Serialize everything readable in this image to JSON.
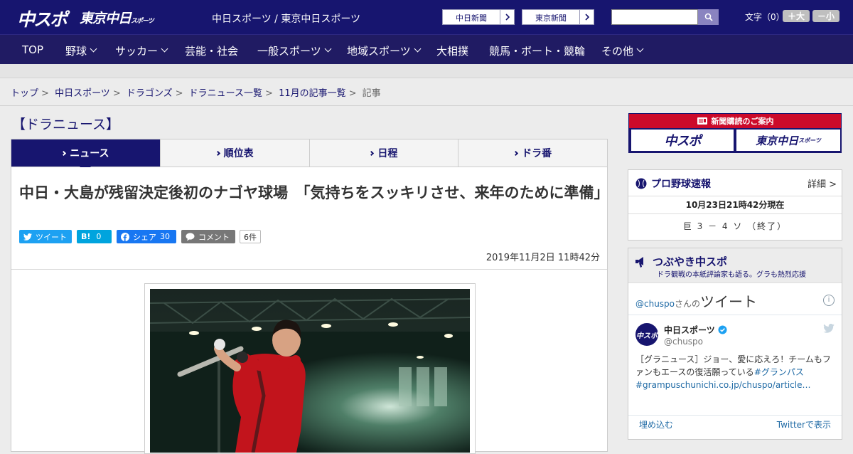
{
  "header": {
    "logo_chuspo": "中スポ",
    "logo_tokyo": "東京中日",
    "logo_tokyo_small": "スポーツ",
    "site_title": "中日スポーツ / 東京中日スポーツ",
    "ext_links": [
      "中日新聞",
      "東京新聞"
    ],
    "font_size_label": "文字（0）",
    "font_bigger": "＋大",
    "font_smaller": "－小"
  },
  "nav": {
    "items": [
      "TOP",
      "野球",
      "サッカー",
      "芸能・社会",
      "一般スポーツ",
      "地域スポーツ",
      "大相撲",
      "競馬・ボート・競輪",
      "その他"
    ]
  },
  "breadcrumb": [
    "トップ",
    "中日スポーツ",
    "ドラゴンズ",
    "ドラニュース一覧",
    "11月の記事一覧",
    "記事"
  ],
  "main": {
    "section_title": "【ドラニュース】",
    "tabs": [
      "ニュース",
      "順位表",
      "日程",
      "ドラ番"
    ],
    "headline": "中日・大島が残留決定後初のナゴヤ球場　「気持ちをスッキリさせ、来年のために準備」",
    "share": {
      "tweet": "ツイート",
      "hatena_label": "B!",
      "hatena_count": "0",
      "facebook": "シェア",
      "facebook_count": "30",
      "comment": "コメント",
      "comment_count": "6件"
    },
    "date": "2019年11月2日 11時42分"
  },
  "sidebar": {
    "subscribe_bar": "新聞購読のご案内",
    "subscribe_logos": [
      "中スポ",
      "東京中日"
    ],
    "subscribe_logo_small": "スポーツ",
    "baseball": {
      "title": "プロ野球速報",
      "detail": "詳細 >",
      "time": "10月23日21時42分現在",
      "score": "巨 3 － 4 ソ （終了）"
    },
    "tsubuyaki": {
      "title": "つぶやき中スポ",
      "subtitle": "ドラ観戦の本紙評論家も語る。グラも熱烈応援",
      "tw_handle_head": "@chuspo",
      "tw_san_no": "さんの",
      "tw_tweet": "ツイート",
      "account_name": "中日スポーツ",
      "account_handle": "@chuspo",
      "avatar_text": "中スポ",
      "tweet_text": "［グラニュース］ジョー、愛に応えろ！チームもファンもエースの復活願っている",
      "tweet_hashtag": "#グランパス",
      "tweet_link": "#grampuschunichi.co.jp/chuspo/article…",
      "embed": "埋め込む",
      "view_on": "Twitterで表示"
    }
  },
  "colors": {
    "brand_navy": "#17156f",
    "nav_bg": "#201b63",
    "subscribe_red": "#cc0a2a",
    "twitter_blue": "#1da1f2",
    "facebook_blue": "#1877f2",
    "hatena_blue": "#00a4de"
  }
}
